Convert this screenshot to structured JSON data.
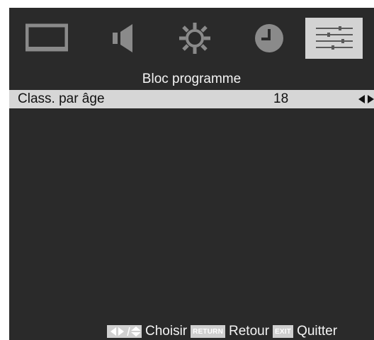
{
  "menu_tabs": [
    {
      "icon": "picture-icon",
      "active": false
    },
    {
      "icon": "sound-icon",
      "active": false
    },
    {
      "icon": "settings-icon",
      "active": false
    },
    {
      "icon": "clock-icon",
      "active": false
    },
    {
      "icon": "options-sliders-icon",
      "active": true
    }
  ],
  "page": {
    "title": "Bloc programme"
  },
  "rows": [
    {
      "label": "Class. par âge",
      "value": "18",
      "control": "left-right-arrows-icon"
    }
  ],
  "footer": {
    "choose_label": "Choisir",
    "return_key": "RETURN",
    "return_label": "Retour",
    "exit_key": "EXIT",
    "exit_label": "Quitter"
  },
  "colors": {
    "background": "#2a2a2a",
    "highlight": "#d6d6d6",
    "icon": "#8a8a8a",
    "text": "#f4f4f4"
  }
}
